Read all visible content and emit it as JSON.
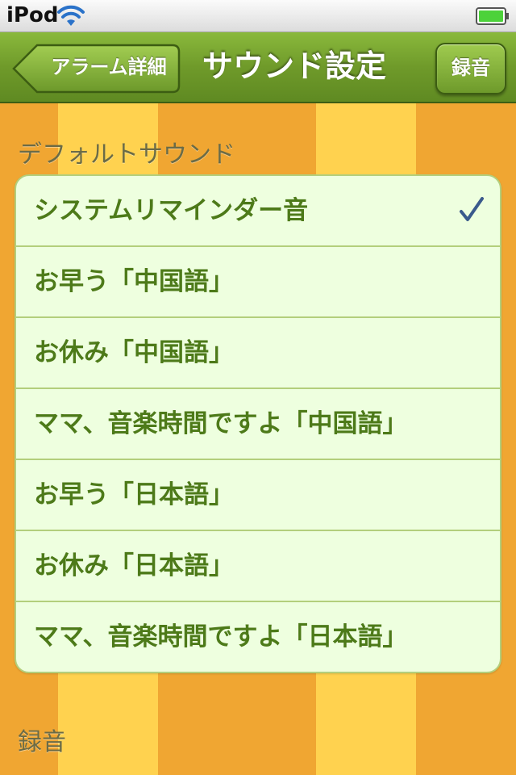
{
  "status_bar": {
    "carrier": "iPod",
    "wifi_icon": "wifi-icon",
    "battery_icon": "battery-icon",
    "battery_color": "#4cd23a"
  },
  "nav_bar": {
    "back_label": "アラーム詳細",
    "title": "サウンド設定",
    "record_label": "録音",
    "bar_color": "#6f9a2a"
  },
  "sections": {
    "default_sound_header": "デフォルトサウンド",
    "recording_header": "録音"
  },
  "sound_list": {
    "items": [
      {
        "label": "システムリマインダー音",
        "selected": true
      },
      {
        "label": "お早う「中国語」",
        "selected": false
      },
      {
        "label": "お休み「中国語」",
        "selected": false
      },
      {
        "label": "ママ、音楽時間ですよ「中国語」",
        "selected": false
      },
      {
        "label": "お早う「日本語」",
        "selected": false
      },
      {
        "label": "お休み「日本語」",
        "selected": false
      },
      {
        "label": "ママ、音楽時間ですよ「日本語」",
        "selected": false
      }
    ],
    "check_icon": "checkmark-icon",
    "check_color": "#3a5a8c"
  },
  "colors": {
    "stripe_dark": "#f0a632",
    "stripe_light": "#ffd24f",
    "row_text": "#4d7a19",
    "row_background": "#eeffdf"
  }
}
